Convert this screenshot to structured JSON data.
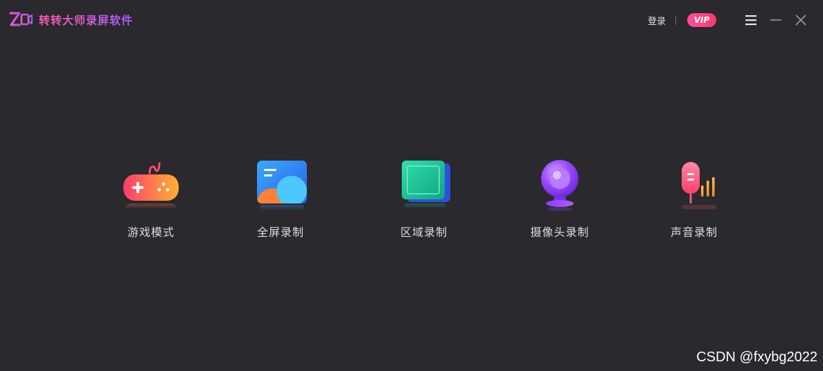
{
  "app": {
    "title": "转转大师录屏软件",
    "accent_pink": "#ff4f9a",
    "accent_purple": "#a45cff",
    "background": "#2a292d"
  },
  "titlebar": {
    "login_label": "登录",
    "vip_label": "VIP",
    "icons": [
      "logo-icon",
      "menu-icon",
      "minimize-icon",
      "close-icon"
    ]
  },
  "tools": [
    {
      "id": "game",
      "label": "游戏模式",
      "icon": "gamepad-icon"
    },
    {
      "id": "fullscreen",
      "label": "全屏录制",
      "icon": "fullscreen-icon"
    },
    {
      "id": "region",
      "label": "区域录制",
      "icon": "region-icon"
    },
    {
      "id": "camera",
      "label": "摄像头录制",
      "icon": "webcam-icon"
    },
    {
      "id": "audio",
      "label": "声音录制",
      "icon": "microphone-icon"
    }
  ],
  "watermark": "CSDN @fxybg2022"
}
